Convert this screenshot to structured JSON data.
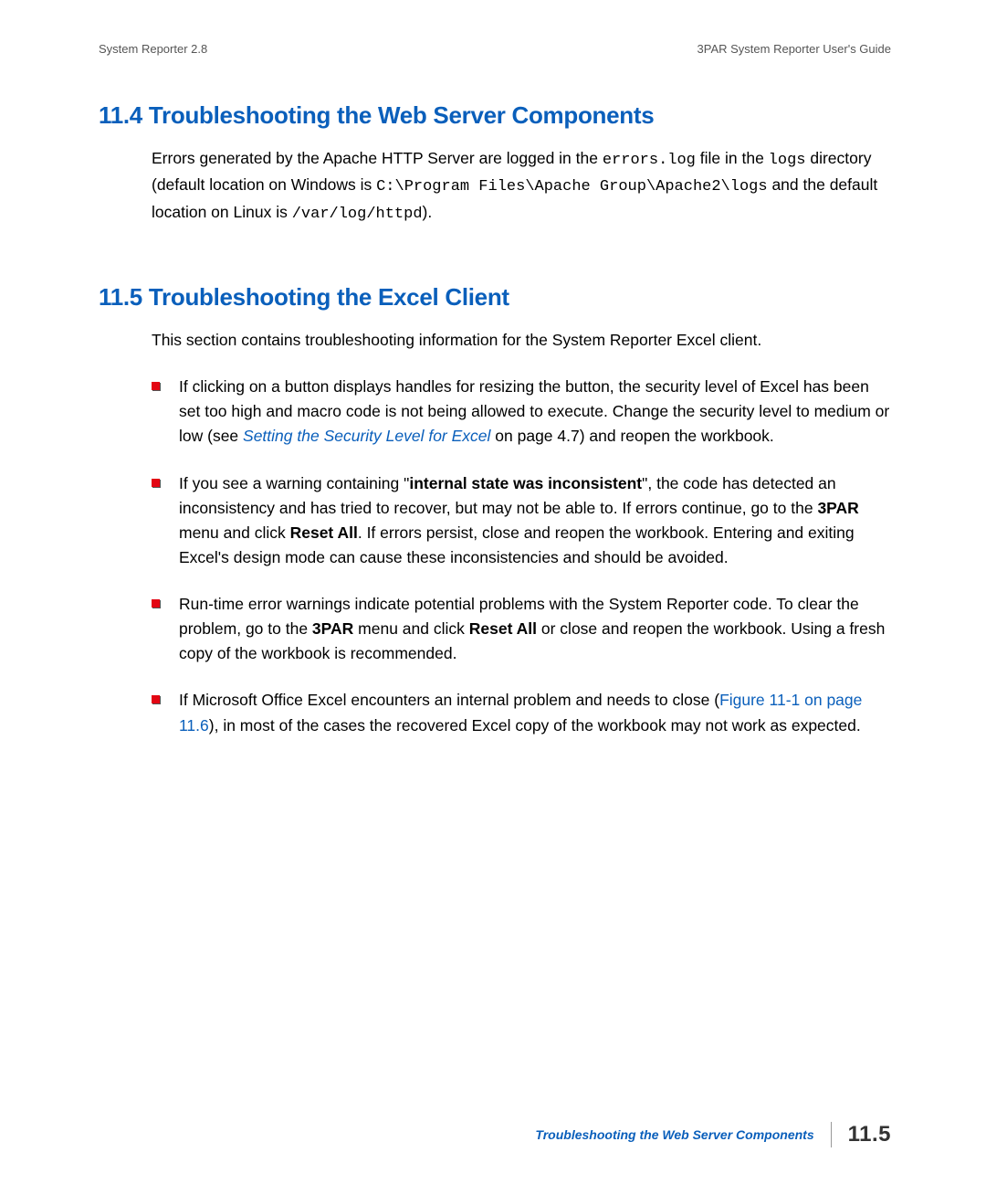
{
  "header": {
    "left": "System Reporter 2.8",
    "right": "3PAR System Reporter User's Guide"
  },
  "section1": {
    "heading": "11.4 Troubleshooting the Web Server Components",
    "p_part1": "Errors generated by the Apache HTTP Server are logged in the ",
    "p_code1": "errors.log",
    "p_part2": " file in the ",
    "p_code2": "logs",
    "p_part3": " directory (default location on Windows is ",
    "p_code3": "C:\\Program Files\\Apache Group\\Apache2\\logs",
    "p_part4": " and the default location on Linux is ",
    "p_code4": "/var/log/httpd",
    "p_part5": ")."
  },
  "section2": {
    "heading": "11.5 Troubleshooting the Excel Client",
    "intro": "This section contains troubleshooting information for the System Reporter Excel client.",
    "bullets": {
      "b1_part1": "If clicking on a button displays handles for resizing the button, the security level of Excel has been set too high and macro code is not being allowed to execute. Change the security level to medium or low (see ",
      "b1_link": "Setting the Security Level for Excel",
      "b1_part2": " on page 4.7) and reopen the workbook.",
      "b2_part1": "If you see a warning containing \"",
      "b2_bold1": "internal state was inconsistent",
      "b2_part2": "\", the code has detected an inconsistency and has tried to recover, but may not be able to. If errors continue, go to the ",
      "b2_bold2": "3PAR",
      "b2_part3": " menu and click ",
      "b2_bold3": "Reset All",
      "b2_part4": ". If errors persist, close and reopen the workbook. Entering and exiting Excel's design mode can cause these inconsistencies and should be avoided.",
      "b3_part1": "Run-time error warnings indicate potential problems with the System Reporter code. To clear the problem, go to the ",
      "b3_bold1": "3PAR",
      "b3_part2": " menu and click ",
      "b3_bold2": "Reset All",
      "b3_part3": " or close and reopen the workbook. Using a fresh copy of the workbook is recommended.",
      "b4_part1": "If Microsoft Office Excel encounters an internal problem and needs to close (",
      "b4_link": "Figure 11-1 on page 11.6",
      "b4_part2": "), in most of the cases the recovered Excel copy of the workbook may not work as expected."
    }
  },
  "footer": {
    "text": "Troubleshooting the Web Server Components",
    "page": "11.5"
  }
}
